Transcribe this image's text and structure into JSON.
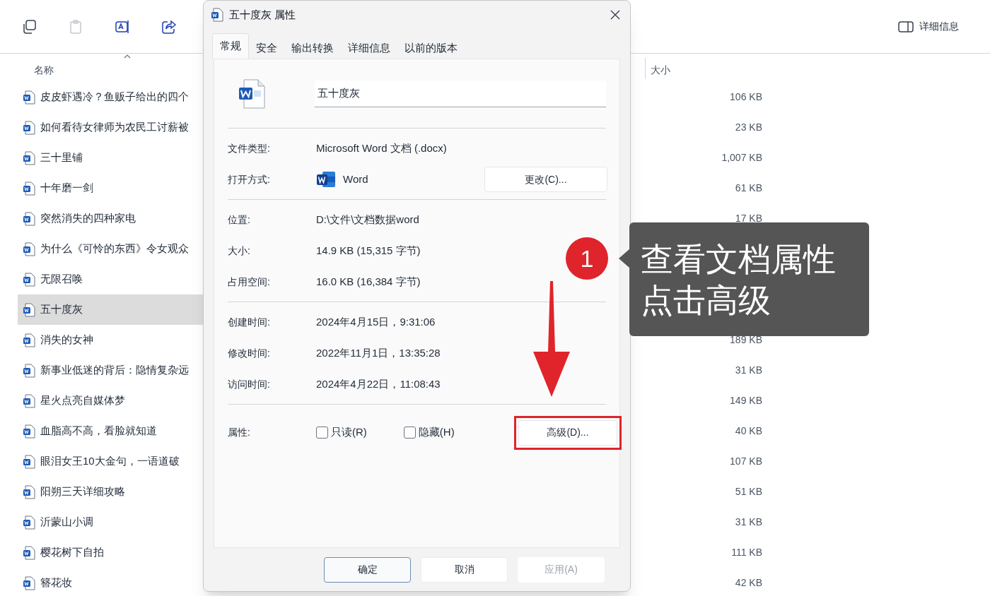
{
  "toolbar": {
    "details_button": "详细信息"
  },
  "file_list": {
    "columns": [
      "名称",
      "大小"
    ],
    "rows": [
      {
        "name": "皮皮虾遇冷？鱼贩子给出的四个",
        "size": "106 KB",
        "selected": false
      },
      {
        "name": "如何看待女律师为农民工讨薪被",
        "size": "23 KB",
        "selected": false
      },
      {
        "name": "三十里铺",
        "size": "1,007 KB",
        "selected": false
      },
      {
        "name": "十年磨一剑",
        "size": "61 KB",
        "selected": false
      },
      {
        "name": "突然消失的四种家电",
        "size": "17 KB",
        "selected": false
      },
      {
        "name": "为什么《可怜的东西》令女观众",
        "selected": false
      },
      {
        "name": "无限召唤",
        "selected": false
      },
      {
        "name": "五十度灰",
        "selected": true
      },
      {
        "name": "消失的女神",
        "size": "189 KB",
        "selected": false
      },
      {
        "name": "新事业低迷的背后：隐情复杂远",
        "size": "31 KB",
        "selected": false
      },
      {
        "name": "星火点亮自媒体梦",
        "size": "149 KB",
        "selected": false
      },
      {
        "name": "血脂高不高，看脸就知道",
        "size": "40 KB",
        "selected": false
      },
      {
        "name": "眼泪女王10大金句，一语道破",
        "size": "107 KB",
        "selected": false
      },
      {
        "name": "阳朔三天详细攻略",
        "size": "51 KB",
        "selected": false
      },
      {
        "name": "沂蒙山小调",
        "size": "31 KB",
        "selected": false
      },
      {
        "name": "樱花树下自拍",
        "size": "111 KB",
        "selected": false
      },
      {
        "name": "簪花妆",
        "size": "42 KB",
        "selected": false
      }
    ]
  },
  "dialog": {
    "title": "五十度灰 属性",
    "tabs": [
      {
        "label": "常规",
        "selected": true
      },
      {
        "label": "安全",
        "selected": false
      },
      {
        "label": "输出转换",
        "selected": false
      },
      {
        "label": "详细信息",
        "selected": false
      },
      {
        "label": "以前的版本",
        "selected": false
      }
    ],
    "file_name": "五十度灰",
    "groups": [
      [
        {
          "kind": "text",
          "label": "文件类型:",
          "value": "Microsoft Word 文档 (.docx)"
        },
        {
          "kind": "app",
          "label": "打开方式:",
          "value": "Word",
          "button": "更改(C)..."
        }
      ],
      [
        {
          "kind": "text",
          "label": "位置:",
          "value": "D:\\文件\\文档数据word"
        },
        {
          "kind": "text",
          "label": "大小:",
          "value": "14.9 KB (15,315 字节)"
        },
        {
          "kind": "text",
          "label": "占用空间:",
          "value": "16.0 KB (16,384 字节)"
        }
      ],
      [
        {
          "kind": "text",
          "label": "创建时间:",
          "value": "2024年4月15日，9:31:06"
        },
        {
          "kind": "text",
          "label": "修改时间:",
          "value": "2022年11月1日，13:35:28"
        },
        {
          "kind": "text",
          "label": "访问时间:",
          "value": "2024年4月22日，11:08:43"
        }
      ]
    ],
    "attributes": {
      "label": "属性:",
      "items": [
        {
          "label": "只读(R)",
          "checked": false
        },
        {
          "label": "隐藏(H)",
          "checked": false
        }
      ],
      "advanced_button": "高级(D)...",
      "highlighted": true
    },
    "buttons": [
      {
        "label": "确定",
        "default": true,
        "disabled": false
      },
      {
        "label": "取消",
        "default": false,
        "disabled": false
      },
      {
        "label": "应用(A)",
        "default": false,
        "disabled": true
      }
    ]
  },
  "annotation": {
    "step": "1",
    "lines": [
      "查看文档属性",
      "点击高级"
    ]
  }
}
